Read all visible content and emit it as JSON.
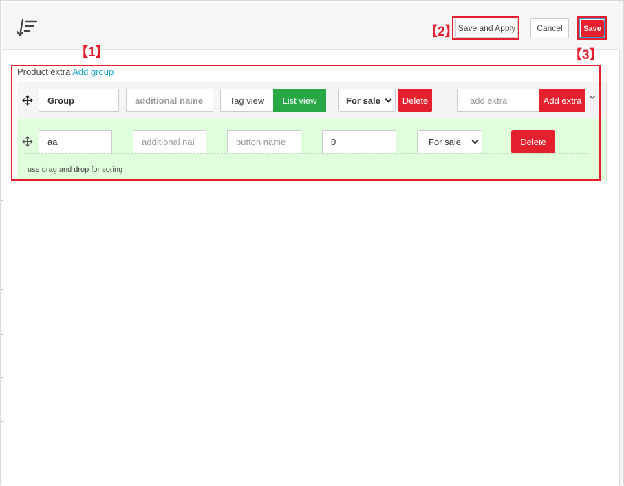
{
  "header": {
    "logo_icon": "sort-filter-logo-icon",
    "save_apply_label": "Save and Apply",
    "cancel_label": "Cancel",
    "save_label": "Save"
  },
  "callouts": {
    "c1": "【1】",
    "c2": "【2】",
    "c3": "【3】"
  },
  "content": {
    "title": "Product extra",
    "add_group_label": "Add group"
  },
  "group": {
    "name_value": "Group",
    "additional_name_placeholder": "additional name",
    "tag_view_label": "Tag view",
    "list_view_label": "List view",
    "sale_select_value": "For sale",
    "delete_label": "Delete",
    "add_extra_placeholder": "add extra",
    "add_extra_label": "Add extra"
  },
  "item": {
    "name_value": "aa",
    "additional_name_placeholder": "additional nai",
    "button_name_placeholder": "button name",
    "price_value": "0",
    "sale_select_value": "For sale",
    "delete_label": "Delete"
  },
  "hint": "use drag and drop for soring",
  "colors": {
    "accent_red": "#e4202e",
    "green": "#28a745",
    "link": "#1aa3c7",
    "item_bg": "#dfffdc"
  }
}
